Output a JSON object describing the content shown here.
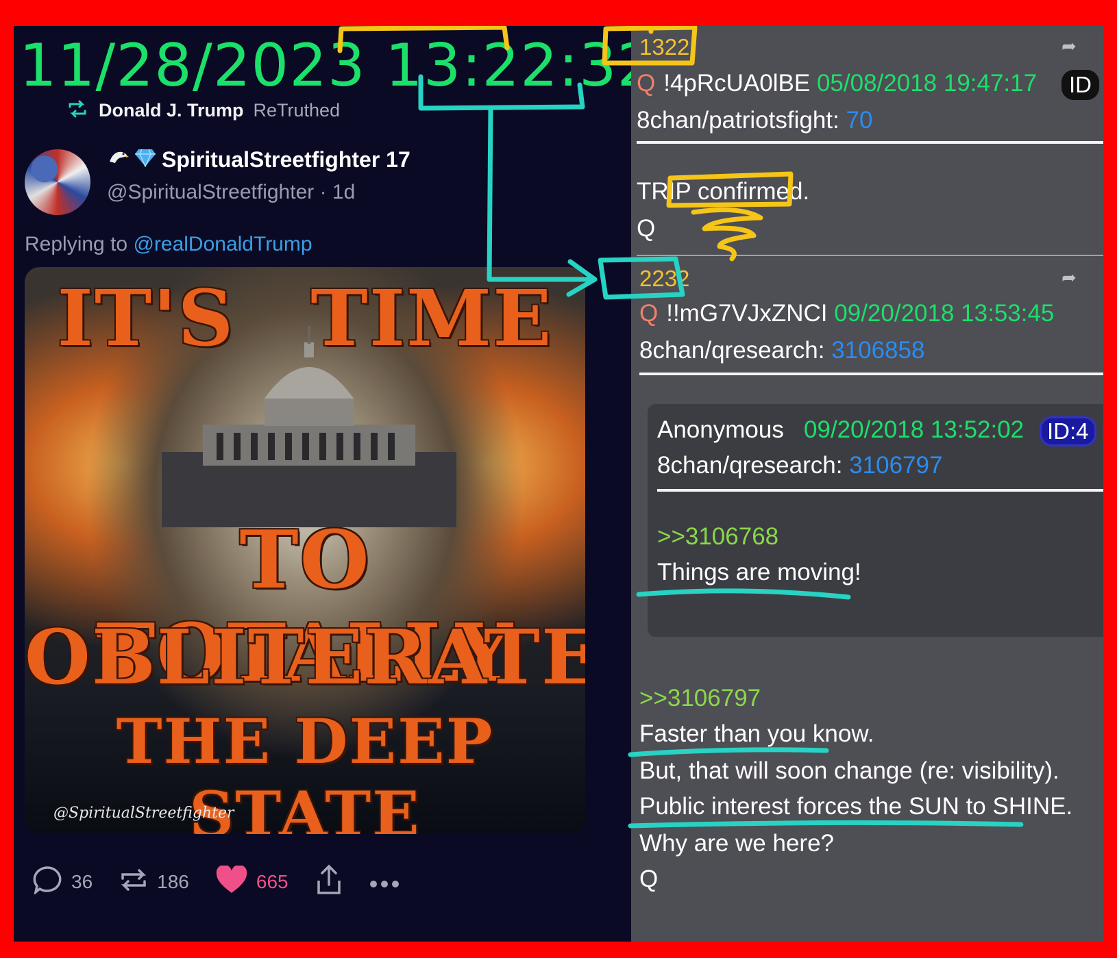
{
  "clock": "11/28/2023 13:22:32",
  "retruth": {
    "name": "Donald J. Trump",
    "suffix": "ReTruthed"
  },
  "author": {
    "name": "SpiritualStreetfighter 17",
    "handle": "@SpiritualStreetfighter · 1d"
  },
  "reply": {
    "prefix": "Replying to ",
    "mention": "@realDonaldTrump"
  },
  "poster": {
    "line1": "IT'S TIME",
    "line2": "TO TOTALLY",
    "line3": "OBLITERATE",
    "line4": "THE DEEP STATE",
    "watermark": "@SpiritualStreetfighter"
  },
  "actions": {
    "replies": "36",
    "retruths": "186",
    "likes": "665"
  },
  "posts": [
    {
      "number": "1322",
      "q": "Q",
      "trip": "!4pRcUA0lBE",
      "date": "05/08/2018 19:47:17",
      "id_pill": "ID",
      "board": "8chan/patriotsfight:",
      "board_num": "70",
      "body1": "TRIP confirmed.",
      "body2": "Q"
    },
    {
      "number": "2232",
      "q": "Q",
      "trip": "!!mG7VJxZNCI",
      "date": "09/20/2018 13:53:45",
      "board": "8chan/qresearch:",
      "board_num": "3106858"
    }
  ],
  "quoted": {
    "author": "Anonymous",
    "date": "09/20/2018 13:52:02",
    "id_pill": "ID:4",
    "board": "8chan/qresearch:",
    "board_num": "3106797",
    "ref": ">>3106768",
    "text": "Things are moving!"
  },
  "reply_post": {
    "ref": ">>3106797",
    "lines": [
      "Faster than you know.",
      "But, that will soon change (re: visibility).",
      "Public interest forces the SUN to SHINE.",
      "Why are we here?",
      "Q"
    ]
  },
  "colors": {
    "frame": "#ff0000",
    "clock": "#1be06a",
    "annotation_yellow": "#f5c518",
    "annotation_cyan": "#27d3c3",
    "poster_text": "#e8601c"
  }
}
